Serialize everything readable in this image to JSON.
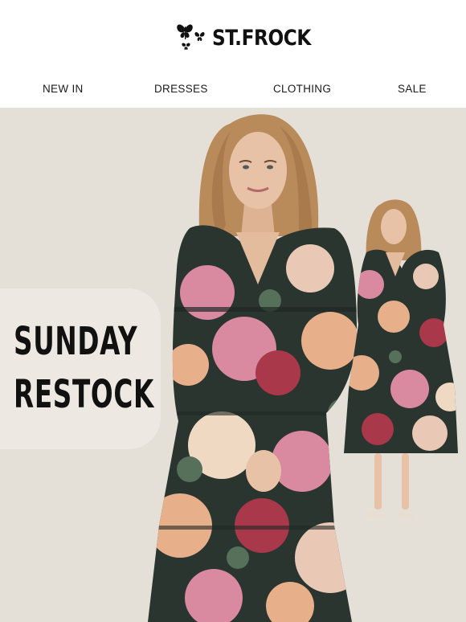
{
  "brand": {
    "name": "ST.FROCK",
    "logo_text": "ST.FROCK"
  },
  "nav": {
    "items": [
      {
        "label": "NEW IN"
      },
      {
        "label": "DRESSES"
      },
      {
        "label": "CLOTHING"
      },
      {
        "label": "SALE"
      }
    ]
  },
  "hero": {
    "headline_line1": "SUNDAY",
    "headline_line2": "RESTOCK",
    "colors": {
      "background": "#e5e0d7",
      "dress_base": "#2a3530",
      "floral_pink": "#d98aa0",
      "floral_peach": "#e7b08a",
      "floral_red": "#a8384a",
      "skin": "#e8c2a6",
      "hair": "#b98a5a"
    }
  }
}
